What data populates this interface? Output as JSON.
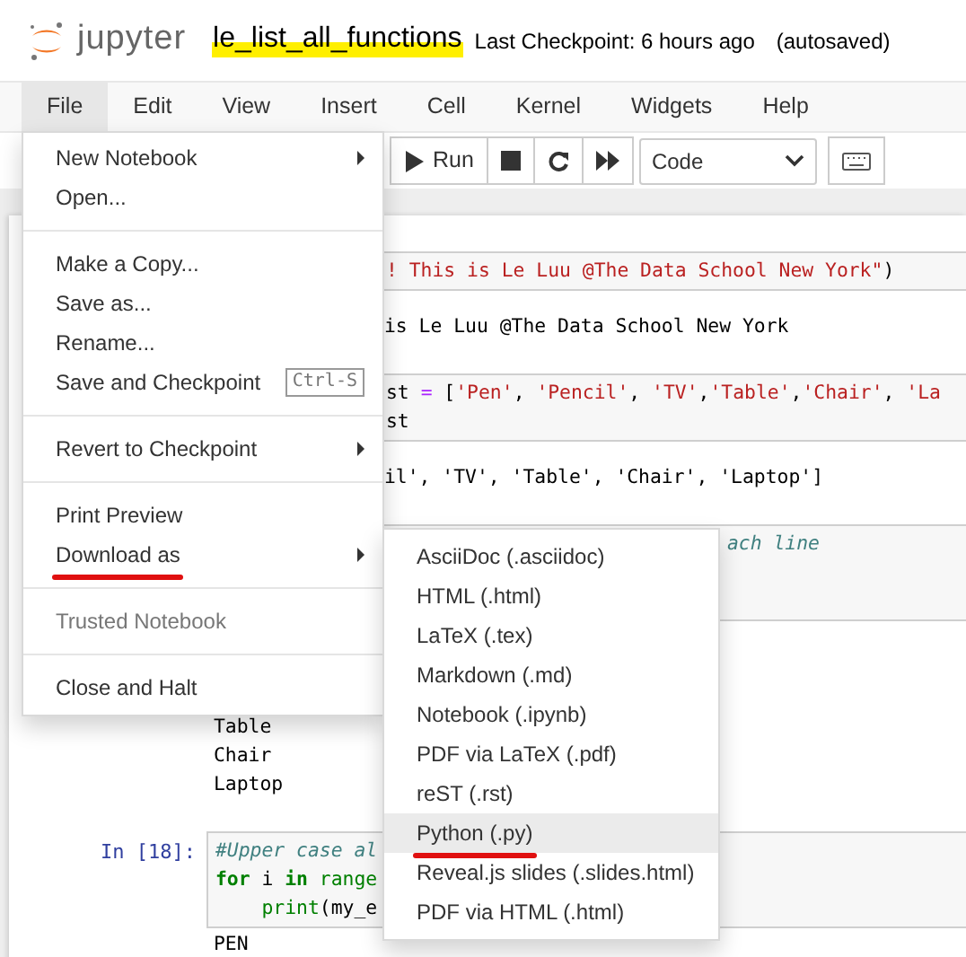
{
  "header": {
    "logo_text": "jupyter",
    "notebook_name": "le_list_all_functions",
    "name_highlighted": true,
    "checkpoint": "Last Checkpoint: 6 hours ago",
    "autosave": "(autosaved)"
  },
  "menubar": [
    {
      "label": "File",
      "selected": true
    },
    {
      "label": "Edit",
      "selected": false
    },
    {
      "label": "View",
      "selected": false
    },
    {
      "label": "Insert",
      "selected": false
    },
    {
      "label": "Cell",
      "selected": false
    },
    {
      "label": "Kernel",
      "selected": false
    },
    {
      "label": "Widgets",
      "selected": false
    },
    {
      "label": "Help",
      "selected": false
    }
  ],
  "toolbar": {
    "run_label": "Run",
    "cell_type": "Code"
  },
  "file_menu": [
    {
      "kind": "item",
      "label": "New Notebook",
      "submenu": true
    },
    {
      "kind": "item",
      "label": "Open..."
    },
    {
      "kind": "divider"
    },
    {
      "kind": "item",
      "label": "Make a Copy..."
    },
    {
      "kind": "item",
      "label": "Save as..."
    },
    {
      "kind": "item",
      "label": "Rename..."
    },
    {
      "kind": "item",
      "label": "Save and Checkpoint",
      "shortcut": "Ctrl-S"
    },
    {
      "kind": "divider"
    },
    {
      "kind": "item",
      "label": "Revert to Checkpoint",
      "submenu": true
    },
    {
      "kind": "divider"
    },
    {
      "kind": "item",
      "label": "Print Preview"
    },
    {
      "kind": "item",
      "label": "Download as",
      "submenu": true,
      "underlined": true
    },
    {
      "kind": "divider"
    },
    {
      "kind": "item",
      "label": "Trusted Notebook",
      "disabled": true
    },
    {
      "kind": "divider"
    },
    {
      "kind": "item",
      "label": "Close and Halt"
    }
  ],
  "download_submenu": [
    {
      "label": "AsciiDoc (.asciidoc)",
      "selected": false
    },
    {
      "label": "HTML (.html)",
      "selected": false
    },
    {
      "label": "LaTeX (.tex)",
      "selected": false
    },
    {
      "label": "Markdown (.md)",
      "selected": false
    },
    {
      "label": "Notebook (.ipynb)",
      "selected": false
    },
    {
      "label": "PDF via LaTeX (.pdf)",
      "selected": false
    },
    {
      "label": "reST (.rst)",
      "selected": false
    },
    {
      "label": "Python (.py)",
      "selected": true,
      "underlined": true
    },
    {
      "label": "Reveal.js slides (.slides.html)",
      "selected": false
    },
    {
      "label": "PDF via HTML (.html)",
      "selected": false
    }
  ],
  "cells": [
    {
      "kind": "covered_input",
      "lines": [
        [
          {
            "text": "! This is Le Luu @The Data School New York\"",
            "kind": "string"
          },
          {
            "text": ")",
            "kind": "plain"
          }
        ]
      ]
    },
    {
      "kind": "covered_output",
      "lines": [
        [
          {
            "text": "is Le Luu @The Data School New York",
            "kind": "plain"
          }
        ]
      ]
    },
    {
      "kind": "covered_input",
      "lines": [
        [
          {
            "text": "st ",
            "kind": "plain"
          },
          {
            "text": "=",
            "kind": "operator"
          },
          {
            "text": " [",
            "kind": "plain"
          },
          {
            "text": "'Pen'",
            "kind": "string"
          },
          {
            "text": ", ",
            "kind": "plain"
          },
          {
            "text": "'Pencil'",
            "kind": "string"
          },
          {
            "text": ", ",
            "kind": "plain"
          },
          {
            "text": "'TV'",
            "kind": "string"
          },
          {
            "text": ",",
            "kind": "plain"
          },
          {
            "text": "'Table'",
            "kind": "string"
          },
          {
            "text": ",",
            "kind": "plain"
          },
          {
            "text": "'Chair'",
            "kind": "string"
          },
          {
            "text": ", ",
            "kind": "plain"
          },
          {
            "text": "'La",
            "kind": "string"
          }
        ],
        [
          {
            "text": "st",
            "kind": "plain"
          }
        ]
      ]
    },
    {
      "kind": "covered_output",
      "lines": [
        [
          {
            "text": "il', 'TV', 'Table', 'Chair', 'Laptop']",
            "kind": "plain"
          }
        ]
      ]
    },
    {
      "kind": "subcovered_input",
      "lines": [
        [
          {
            "text": "ach line",
            "kind": "comment"
          }
        ]
      ]
    },
    {
      "kind": "topcovered_output",
      "lines": [
        [
          {
            "text": "Table",
            "kind": "plain"
          }
        ],
        [
          {
            "text": "Chair",
            "kind": "plain"
          }
        ],
        [
          {
            "text": "Laptop",
            "kind": "plain"
          }
        ]
      ]
    },
    {
      "kind": "input",
      "prompt": "In [18]:",
      "lines": [
        [
          {
            "text": "#Upper case al",
            "kind": "comment"
          }
        ],
        [
          {
            "text": "for",
            "kind": "keyword"
          },
          {
            "text": " i ",
            "kind": "plain"
          },
          {
            "text": "in",
            "kind": "keyword"
          },
          {
            "text": " range",
            "kind": "builtin"
          }
        ],
        [
          {
            "text": "    print",
            "kind": "builtin"
          },
          {
            "text": "(my_e",
            "kind": "plain"
          }
        ]
      ]
    },
    {
      "kind": "cut_output",
      "lines": [
        [
          {
            "text": "PEN",
            "kind": "plain"
          }
        ]
      ]
    }
  ]
}
